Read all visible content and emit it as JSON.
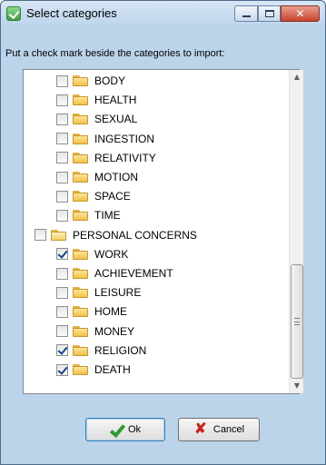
{
  "window": {
    "title": "Select categories",
    "icon": "app-checkmark-icon"
  },
  "caption_buttons": {
    "close_label": "✕"
  },
  "instructions": "Put a check mark beside the categories to import:",
  "tree": [
    {
      "label": "BODY",
      "checked": false,
      "level": 1,
      "open": false
    },
    {
      "label": "HEALTH",
      "checked": false,
      "level": 1,
      "open": false
    },
    {
      "label": "SEXUAL",
      "checked": false,
      "level": 1,
      "open": false
    },
    {
      "label": "INGESTION",
      "checked": false,
      "level": 1,
      "open": false
    },
    {
      "label": "RELATIVITY",
      "checked": false,
      "level": 1,
      "open": false
    },
    {
      "label": "MOTION",
      "checked": false,
      "level": 1,
      "open": false
    },
    {
      "label": "SPACE",
      "checked": false,
      "level": 1,
      "open": false
    },
    {
      "label": "TIME",
      "checked": false,
      "level": 1,
      "open": false
    },
    {
      "label": "PERSONAL CONCERNS",
      "checked": false,
      "level": 0,
      "open": true
    },
    {
      "label": "WORK",
      "checked": true,
      "level": 1,
      "open": false
    },
    {
      "label": "ACHIEVEMENT",
      "checked": false,
      "level": 1,
      "open": false
    },
    {
      "label": "LEISURE",
      "checked": false,
      "level": 1,
      "open": false
    },
    {
      "label": "HOME",
      "checked": false,
      "level": 1,
      "open": false
    },
    {
      "label": "MONEY",
      "checked": false,
      "level": 1,
      "open": false
    },
    {
      "label": "RELIGION",
      "checked": true,
      "level": 1,
      "open": false
    },
    {
      "label": "DEATH",
      "checked": true,
      "level": 1,
      "open": false
    }
  ],
  "buttons": {
    "ok": "Ok",
    "cancel": "Cancel"
  },
  "colors": {
    "ok_icon": "#2e9a2e",
    "cancel_icon": "#c8261b",
    "checkmark": "#1b3f8f"
  }
}
